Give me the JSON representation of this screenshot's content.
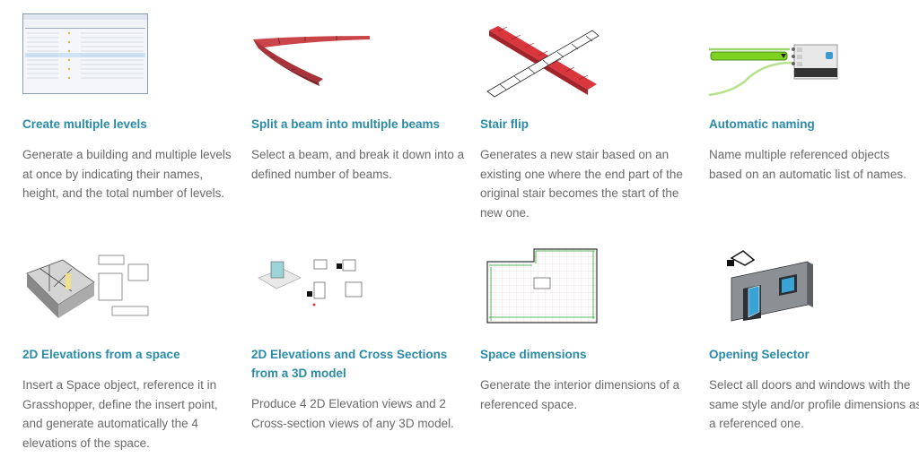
{
  "colors": {
    "title": "#2a8ba8",
    "text": "#6a6a6a",
    "accent_red": "#d9363e",
    "accent_green": "#7ed321"
  },
  "features": [
    {
      "title": "Create multiple levels",
      "description": "Generate a building and multiple levels at once by indicating their names, height, and the total number of levels.",
      "image": "levels-table-screenshot"
    },
    {
      "title": "Split a beam into multiple beams",
      "description": "Select a beam, and break it down into a defined number of beams.",
      "image": "split-beam-render"
    },
    {
      "title": "Stair flip",
      "description": "Generates a new stair based on an existing one where the end part of the original stair becomes the start of the new one.",
      "image": "stair-flip-render"
    },
    {
      "title": "Automatic naming",
      "description": "Name multiple referenced objects based on an automatic list of names.",
      "image": "grasshopper-update-property-node"
    },
    {
      "title": "2D Elevations from a space",
      "description": "Insert a Space object, reference it in Grasshopper, define the insert point, and generate automatically the 4 elevations of the space.",
      "image": "space-elevations-render"
    },
    {
      "title": "2D Elevations and Cross Sections from a 3D model",
      "description": "Produce 4 2D Elevation views and 2 Cross-section views of any 3D model.",
      "image": "model-sections-render"
    },
    {
      "title": "Space dimensions",
      "description": "Generate the interior dimensions of a referenced space.",
      "image": "space-dimensions-plan"
    },
    {
      "title": "Opening Selector",
      "description": "Select all doors and windows with the same style and/or profile dimensions as a referenced one.",
      "image": "opening-selector-illustration"
    }
  ]
}
